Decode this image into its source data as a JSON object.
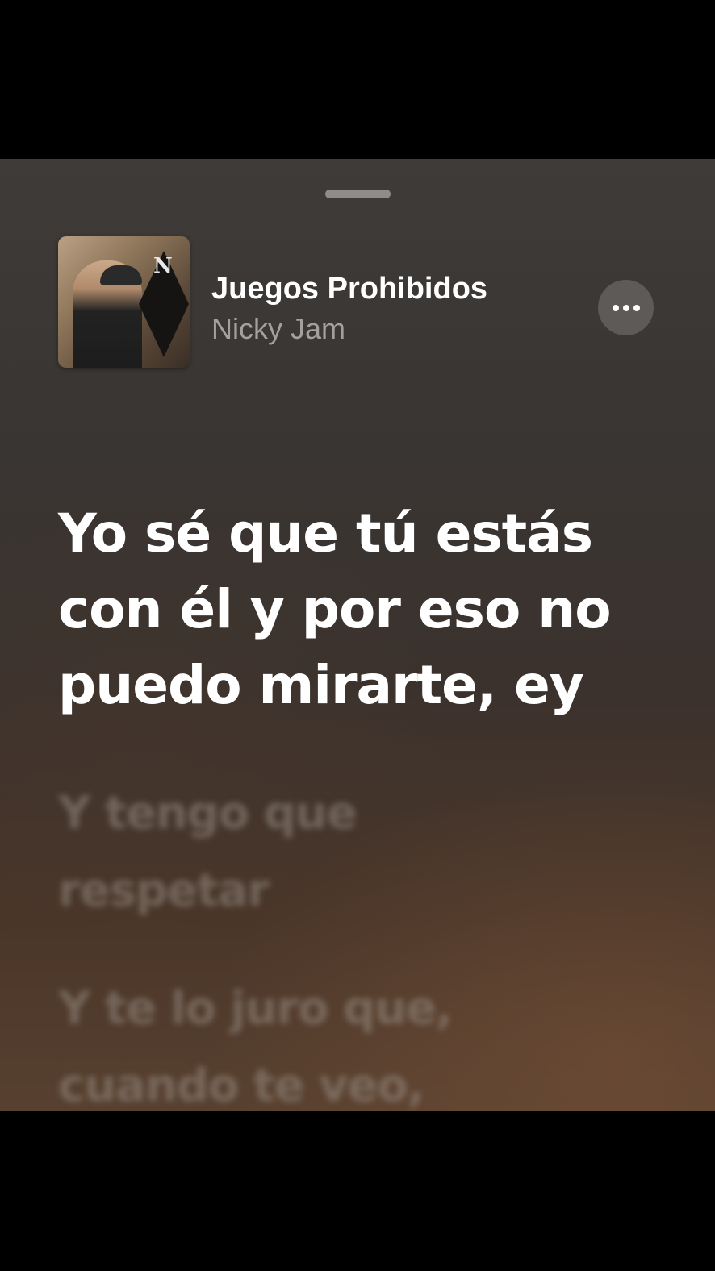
{
  "player": {
    "song_title": "Juegos Prohibidos",
    "artist": "Nicky Jam",
    "artwork_icon": "album-artwork",
    "more_icon": "ellipsis-icon"
  },
  "lyrics": {
    "current": "Yo sé que tú estás con él y por eso no puedo mirarte, ey",
    "upcoming": [
      "Y tengo que respetar",
      "Y te lo juro que, cuando te veo,"
    ]
  },
  "colors": {
    "background_top": "#3e3b39",
    "background_bottom": "#57402f",
    "title": "#ffffff",
    "artist": "#a3a09d",
    "button_bg": "#5e5a58"
  }
}
